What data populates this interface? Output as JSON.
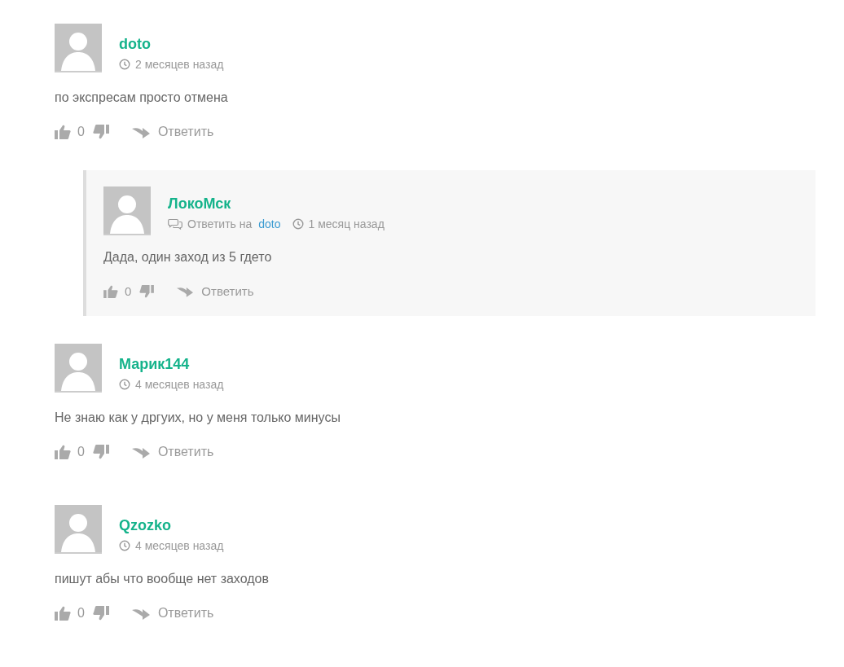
{
  "comments": [
    {
      "author": "doto",
      "time": "2 месяцев назад",
      "text": "по экспресам просто отмена",
      "likes": "0",
      "reply_label": "Ответить",
      "replies": [
        {
          "author": "ЛокоМск",
          "reply_to_label": "Ответить на",
          "reply_to": "doto",
          "time": "1 месяц назад",
          "text": "Дада, один заход из 5 гдето",
          "likes": "0",
          "reply_label": "Ответить"
        }
      ]
    },
    {
      "author": "Марик144",
      "time": "4 месяцев назад",
      "text": "Не знаю как у дргуих, но у меня только минусы",
      "likes": "0",
      "reply_label": "Ответить"
    },
    {
      "author": "Qzozko",
      "time": "4 месяцев назад",
      "text": "пишут абы что вообще нет заходов",
      "likes": "0",
      "reply_label": "Ответить"
    }
  ]
}
